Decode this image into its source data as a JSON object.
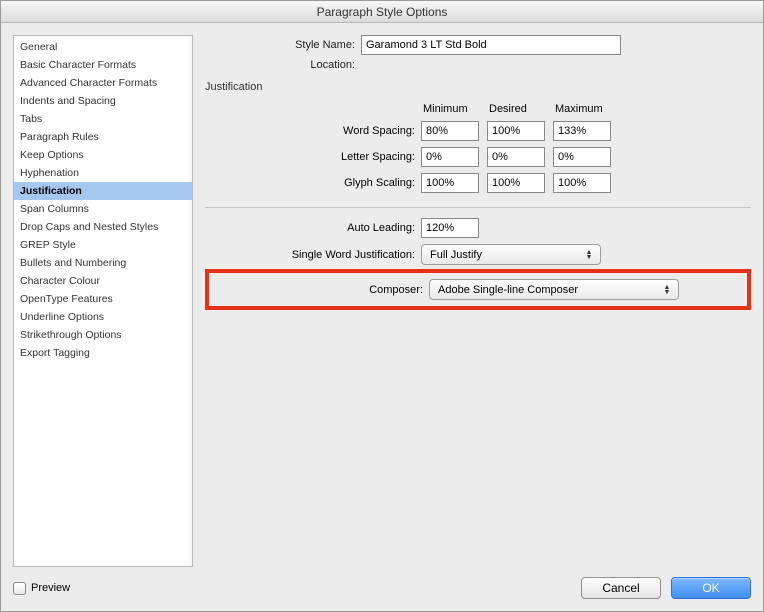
{
  "window": {
    "title": "Paragraph Style Options"
  },
  "sidebar": {
    "items": [
      "General",
      "Basic Character Formats",
      "Advanced Character Formats",
      "Indents and Spacing",
      "Tabs",
      "Paragraph Rules",
      "Keep Options",
      "Hyphenation",
      "Justification",
      "Span Columns",
      "Drop Caps and Nested Styles",
      "GREP Style",
      "Bullets and Numbering",
      "Character Colour",
      "OpenType Features",
      "Underline Options",
      "Strikethrough Options",
      "Export Tagging"
    ],
    "selected_index": 8
  },
  "header": {
    "style_name_label": "Style Name:",
    "style_name_value": "Garamond 3 LT Std Bold",
    "location_label": "Location:"
  },
  "section": {
    "heading": "Justification",
    "columns": {
      "min": "Minimum",
      "des": "Desired",
      "max": "Maximum"
    },
    "rows": {
      "word_spacing": {
        "label": "Word Spacing:",
        "min": "80%",
        "des": "100%",
        "max": "133%"
      },
      "letter_spacing": {
        "label": "Letter Spacing:",
        "min": "0%",
        "des": "0%",
        "max": "0%"
      },
      "glyph_scaling": {
        "label": "Glyph Scaling:",
        "min": "100%",
        "des": "100%",
        "max": "100%"
      }
    },
    "auto_leading": {
      "label": "Auto Leading:",
      "value": "120%"
    },
    "single_word": {
      "label": "Single Word Justification:",
      "value": "Full Justify"
    },
    "composer": {
      "label": "Composer:",
      "value": "Adobe Single-line Composer"
    }
  },
  "footer": {
    "preview_label": "Preview",
    "cancel": "Cancel",
    "ok": "OK"
  }
}
